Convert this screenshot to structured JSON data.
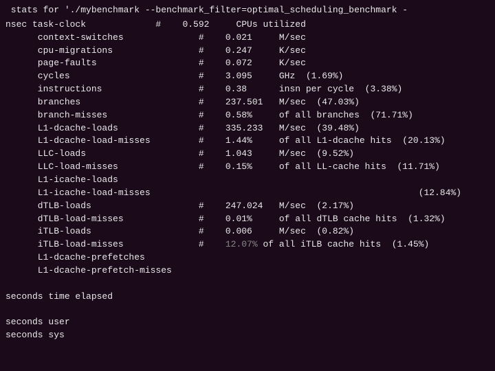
{
  "terminal": {
    "header": " stats for './mybenchmark --benchmark_filter=optimal_scheduling_benchmark -",
    "lines": [
      {
        "indent": 0,
        "name": "nsec task-clock",
        "hash": "#",
        "value": "0.592",
        "unit": "CPUs utilized",
        "extra": ""
      },
      {
        "indent": 1,
        "name": "context-switches",
        "hash": "#",
        "value": "0.021",
        "unit": "M/sec",
        "extra": ""
      },
      {
        "indent": 1,
        "name": "cpu-migrations",
        "hash": "#",
        "value": "0.247",
        "unit": "K/sec",
        "extra": ""
      },
      {
        "indent": 1,
        "name": "page-faults",
        "hash": "#",
        "value": "0.072",
        "unit": "K/sec",
        "extra": ""
      },
      {
        "indent": 1,
        "name": "cycles",
        "hash": "#",
        "value": "3.095",
        "unit": "GHz",
        "extra": "(1.69%)"
      },
      {
        "indent": 1,
        "name": "instructions",
        "hash": "#",
        "value": "0.38",
        "unit": "insn per cycle",
        "extra": "(3.38%)"
      },
      {
        "indent": 1,
        "name": "branches",
        "hash": "#",
        "value": "237.501",
        "unit": "M/sec",
        "extra": "(47.03%)"
      },
      {
        "indent": 1,
        "name": "branch-misses",
        "hash": "#",
        "value": "0.58%",
        "unit": "of all branches",
        "extra": "(71.71%)"
      },
      {
        "indent": 1,
        "name": "L1-dcache-loads",
        "hash": "#",
        "value": "335.233",
        "unit": "M/sec",
        "extra": "(39.48%)"
      },
      {
        "indent": 1,
        "name": "L1-dcache-load-misses",
        "hash": "#",
        "value": "1.44%",
        "unit": "of all L1-dcache hits",
        "extra": "(20.13%)"
      },
      {
        "indent": 1,
        "name": "LLC-loads",
        "hash": "#",
        "value": "1.043",
        "unit": "M/sec",
        "extra": "(9.52%)"
      },
      {
        "indent": 1,
        "name": "LLC-load-misses",
        "hash": "#",
        "value": "0.15%",
        "unit": "of all LL-cache hits",
        "extra": "(11.71%)"
      },
      {
        "indent": 1,
        "name": "L1-icache-loads",
        "hash": "",
        "value": "",
        "unit": "",
        "extra": ""
      },
      {
        "indent": 1,
        "name": "L1-icache-load-misses",
        "hash": "",
        "value": "",
        "unit": "",
        "extra": "(12.84%)"
      },
      {
        "indent": 1,
        "name": "dTLB-loads",
        "hash": "#",
        "value": "247.024",
        "unit": "M/sec",
        "extra": "(2.17%)"
      },
      {
        "indent": 1,
        "name": "dTLB-load-misses",
        "hash": "#",
        "value": "0.01%",
        "unit": "of all dTLB cache hits",
        "extra": "(1.32%)"
      },
      {
        "indent": 1,
        "name": "iTLB-loads",
        "hash": "#",
        "value": "0.006",
        "unit": "M/sec",
        "extra": "(0.82%)"
      },
      {
        "indent": 1,
        "name": "iTLB-load-misses",
        "hash": "#",
        "value_dimmed": "12.07%",
        "unit": "of all iTLB cache hits",
        "extra": "(1.45%)"
      },
      {
        "indent": 1,
        "name": "L1-dcache-prefetches",
        "hash": "",
        "value": "",
        "unit": "",
        "extra": ""
      },
      {
        "indent": 1,
        "name": "L1-dcache-prefetch-misses",
        "hash": "",
        "value": "",
        "unit": "",
        "extra": ""
      }
    ],
    "footer_lines": [
      "",
      "seconds time elapsed",
      "",
      "seconds user",
      "seconds sys"
    ]
  }
}
